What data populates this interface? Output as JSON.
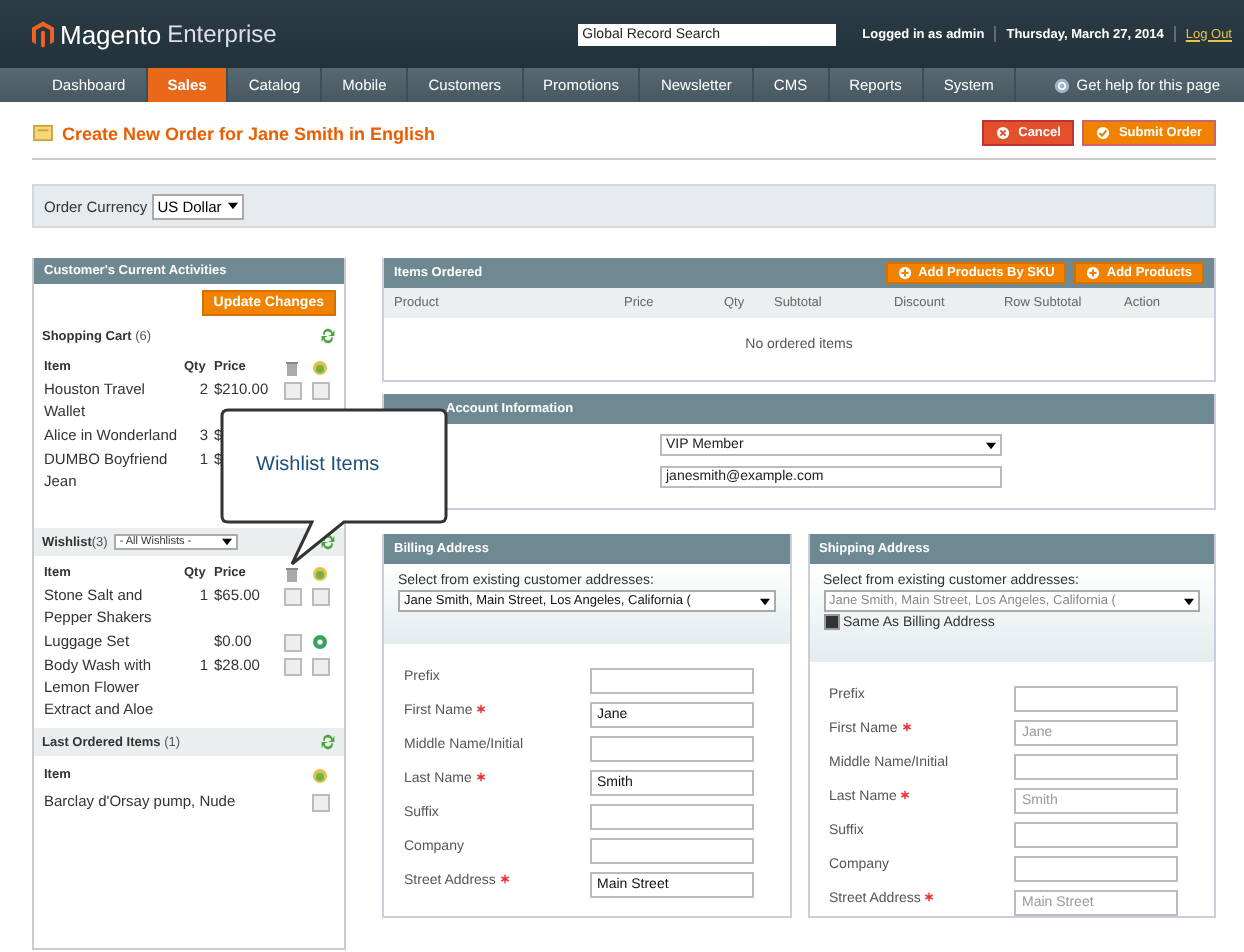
{
  "header": {
    "logo_main": "Magento",
    "logo_sub": "Enterprise",
    "search": {
      "placeholder": "Global Record Search"
    },
    "user": "Logged in as admin",
    "date": "Thursday, March 27, 2014",
    "logout": "Log Out"
  },
  "nav": {
    "items": [
      {
        "label": "Dashboard",
        "selected": false
      },
      {
        "label": "Sales",
        "selected": true
      },
      {
        "label": "Catalog",
        "selected": false
      },
      {
        "label": "Mobile",
        "selected": false
      },
      {
        "label": "Customers",
        "selected": false
      },
      {
        "label": "Promotions",
        "selected": false
      },
      {
        "label": "Newsletter",
        "selected": false
      },
      {
        "label": "CMS",
        "selected": false
      },
      {
        "label": "Reports",
        "selected": false
      },
      {
        "label": "System",
        "selected": false
      }
    ],
    "help": "Get help for this page"
  },
  "page_title": "Create New Order for Jane Smith in English",
  "actions": [
    {
      "label": "Cancel",
      "kind": "cancel"
    },
    {
      "label": "Submit Order",
      "kind": "submit"
    }
  ],
  "currency": {
    "label": "Order Currency",
    "value": "US Dollar"
  },
  "activities": {
    "title": "Customer's Current Activities",
    "update_button": "Update Changes",
    "shopping_cart": {
      "title": "Shopping Cart",
      "count": "(6)",
      "columns": [
        "Item",
        "Qty",
        "Price"
      ],
      "items": [
        {
          "name": "Houston Travel Wallet",
          "qty": "2",
          "price": "$210.00",
          "remove_checked": false,
          "add_checked": false
        },
        {
          "name": "Alice in Wonderland",
          "qty": "3",
          "price": "$"
        },
        {
          "name": "DUMBO Boyfriend Jean",
          "qty": "1",
          "price": "$"
        }
      ]
    },
    "wishlist": {
      "title": "Wishlist",
      "count": "(3)",
      "select": "- All Wishlists -",
      "columns": [
        "Item",
        "Qty",
        "Price"
      ],
      "items": [
        {
          "name": "Stone Salt and Pepper Shakers",
          "qty": "1",
          "price": "$65.00",
          "remove_checked": false,
          "added": false
        },
        {
          "name": "Luggage Set",
          "price": "$0.00",
          "remove_checked": false,
          "added": true
        },
        {
          "name": "Body Wash with Lemon Flower Extract and Aloe",
          "qty": "1",
          "price": "$28.00",
          "remove_checked": false,
          "added": false
        }
      ]
    },
    "last_ordered": {
      "title": "Last Ordered Items",
      "count": "(1)",
      "columns": [
        "Item"
      ],
      "items": [
        {
          "name": "Barclay d'Orsay pump, Nude",
          "add_checked": false
        }
      ]
    }
  },
  "callout": "Wishlist Items",
  "items_ordered": {
    "title": "Items Ordered",
    "buttons": [
      "Add Products By SKU",
      "Add Products"
    ],
    "columns": [
      "Product",
      "Price",
      "Qty",
      "Subtotal",
      "Discount",
      "Row Subtotal",
      "Action"
    ],
    "empty": "No ordered items"
  },
  "account": {
    "title": "Account Information",
    "group": "VIP Member",
    "email": "janesmith@example.com"
  },
  "addresses": [
    {
      "title": "Billing Address",
      "select_label": "Select from existing customer addresses:",
      "select_value": "Jane Smith, Main Street, Los Angeles, California (",
      "disabled": false,
      "fields": [
        {
          "label": "Prefix",
          "required": false
        },
        {
          "label": "First Name",
          "required": true,
          "value": "Jane"
        },
        {
          "label": "Middle Name/Initial",
          "required": false
        },
        {
          "label": "Last Name",
          "required": true,
          "value": "Smith"
        },
        {
          "label": "Suffix",
          "required": false
        },
        {
          "label": "Company",
          "required": false
        },
        {
          "label": "Street Address",
          "required": true,
          "value": "Main Street"
        }
      ]
    },
    {
      "title": "Shipping Address",
      "select_label": "Select from existing customer addresses:",
      "select_value": "Jane Smith, Main Street, Los Angeles, California (",
      "same_as_billing": {
        "label": "Same As Billing Address",
        "checked": true
      },
      "disabled": true,
      "fields": [
        {
          "label": "Prefix",
          "required": false
        },
        {
          "label": "First Name",
          "required": true,
          "value": "Jane"
        },
        {
          "label": "Middle Name/Initial",
          "required": false
        },
        {
          "label": "Last Name",
          "required": true,
          "value": "Smith"
        },
        {
          "label": "Suffix",
          "required": false
        },
        {
          "label": "Company",
          "required": false
        },
        {
          "label": "Street Address",
          "required": true,
          "value": "Main Street"
        }
      ]
    }
  ]
}
